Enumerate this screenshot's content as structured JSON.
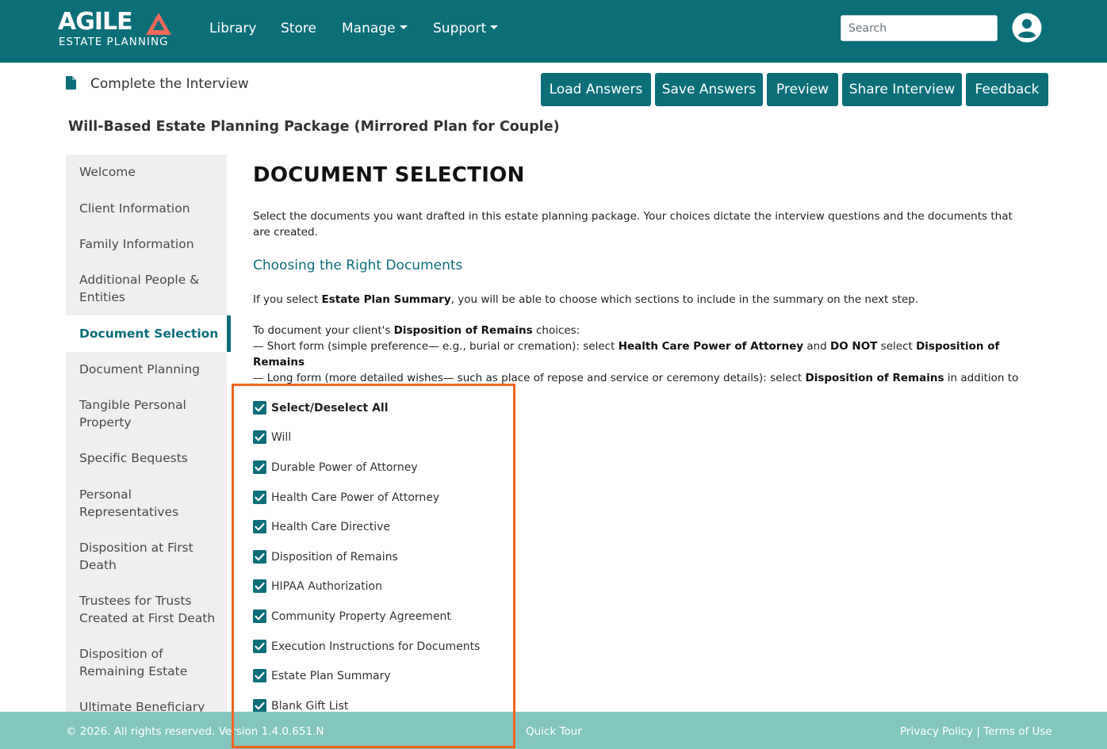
{
  "navbar": {
    "logo_main": "AGILE",
    "logo_sub": "ESTATE PLANNING",
    "links": {
      "library": "Library",
      "store": "Store",
      "manage": "Manage",
      "support": "Support"
    },
    "search_placeholder": "Search",
    "user_icon": "user-circle-icon"
  },
  "header": {
    "page_title": "Complete the Interview",
    "buttons": {
      "load": "Load Answers",
      "save": "Save Answers",
      "preview": "Preview",
      "share": "Share Interview",
      "feedback": "Feedback"
    },
    "package_title": "Will-Based Estate Planning Package (Mirrored Plan for Couple)"
  },
  "sidebar": {
    "items": [
      "Welcome",
      "Client Information",
      "Family Information",
      "Additional People & Entities",
      "Document Selection",
      "Document Planning",
      "Tangible Personal Property",
      "Specific Bequests",
      "Personal Representatives",
      "Disposition at First Death",
      "Trustees for Trusts Created at First Death",
      "Disposition of Remaining Estate",
      "Ultimate Beneficiary"
    ],
    "active": "Document Selection"
  },
  "main": {
    "heading": "DOCUMENT SELECTION",
    "intro": "Select the documents you want drafted in this estate planning package. Your choices dictate the interview questions and the documents that are created.",
    "subheading": "Choosing the Right Documents",
    "summary_note": {
      "prefix": "If you select ",
      "bold": "Estate Plan Summary",
      "suffix": ", you will be able to choose which sections to include in the summary on the next step."
    },
    "remains_note": {
      "line1_prefix": "To document your client's ",
      "line1_bold": "Disposition of Remains",
      "line1_suffix": " choices:",
      "line2_prefix": "— Short form (simple preference— e.g., burial or cremation): select ",
      "line2_bold1": "Health Care Power of Attorney",
      "line2_mid": " and ",
      "line2_bold2": "DO NOT",
      "line2_mid2": " select ",
      "line2_bold3": "Disposition of Remains",
      "line3_prefix": "— Long form (more detailed wishes— such as place of repose and service or ceremony details): select ",
      "line3_bold": "Disposition of Remains",
      "line3_suffix": " in addition to the Health Care Power of Attorney"
    },
    "checkboxes": [
      {
        "label": "Select/Deselect All",
        "checked": true
      },
      {
        "label": "Will",
        "checked": true
      },
      {
        "label": "Durable Power of Attorney",
        "checked": true
      },
      {
        "label": "Health Care Power of Attorney",
        "checked": true
      },
      {
        "label": "Health Care Directive",
        "checked": true
      },
      {
        "label": "Disposition of Remains",
        "checked": true
      },
      {
        "label": "HIPAA Authorization",
        "checked": true
      },
      {
        "label": "Community Property Agreement",
        "checked": true
      },
      {
        "label": "Execution Instructions for Documents",
        "checked": true
      },
      {
        "label": "Estate Plan Summary",
        "checked": true
      },
      {
        "label": "Blank Gift List",
        "checked": true
      }
    ]
  },
  "footer": {
    "copyright": "© 2026. All rights reserved. Version 1.4.0.651.N",
    "quick_tour": "Quick Tour",
    "privacy": "Privacy Policy",
    "separator": "|",
    "terms": "Terms of Use"
  },
  "colors": {
    "brand_teal": "#0b6e79",
    "footer_teal": "#84c6bd",
    "logo_accent": "#f26a5b",
    "highlight_orange": "#f0651e"
  }
}
